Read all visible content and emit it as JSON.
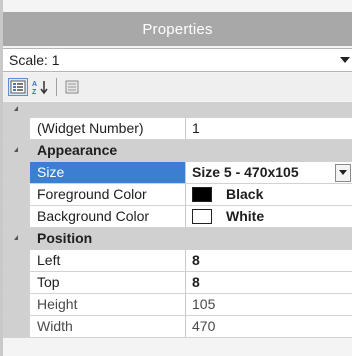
{
  "panel": {
    "title": "Properties"
  },
  "scale_selector": {
    "value": "Scale: 1"
  },
  "toolbar": {
    "icons": [
      "categorized-icon",
      "sort-az-icon",
      "property-pages-icon"
    ]
  },
  "widget_row": {
    "name": "(Widget Number)",
    "value": "1"
  },
  "appearance": {
    "label": "Appearance",
    "size": {
      "name": "Size",
      "value": "Size 5 - 470x105"
    },
    "foreground": {
      "name": "Foreground Color",
      "value": "Black",
      "color": "#000000"
    },
    "background": {
      "name": "Background Color",
      "value": "White",
      "color": "#ffffff"
    }
  },
  "position": {
    "label": "Position",
    "left": {
      "name": "Left",
      "value": "8"
    },
    "top": {
      "name": "Top",
      "value": "8"
    },
    "height": {
      "name": "Height",
      "value": "105"
    },
    "width": {
      "name": "Width",
      "value": "470"
    }
  },
  "colors": {
    "title_bar": "#a8a8a8",
    "selection": "#3a7fd0",
    "category": "#d0d0d0"
  }
}
